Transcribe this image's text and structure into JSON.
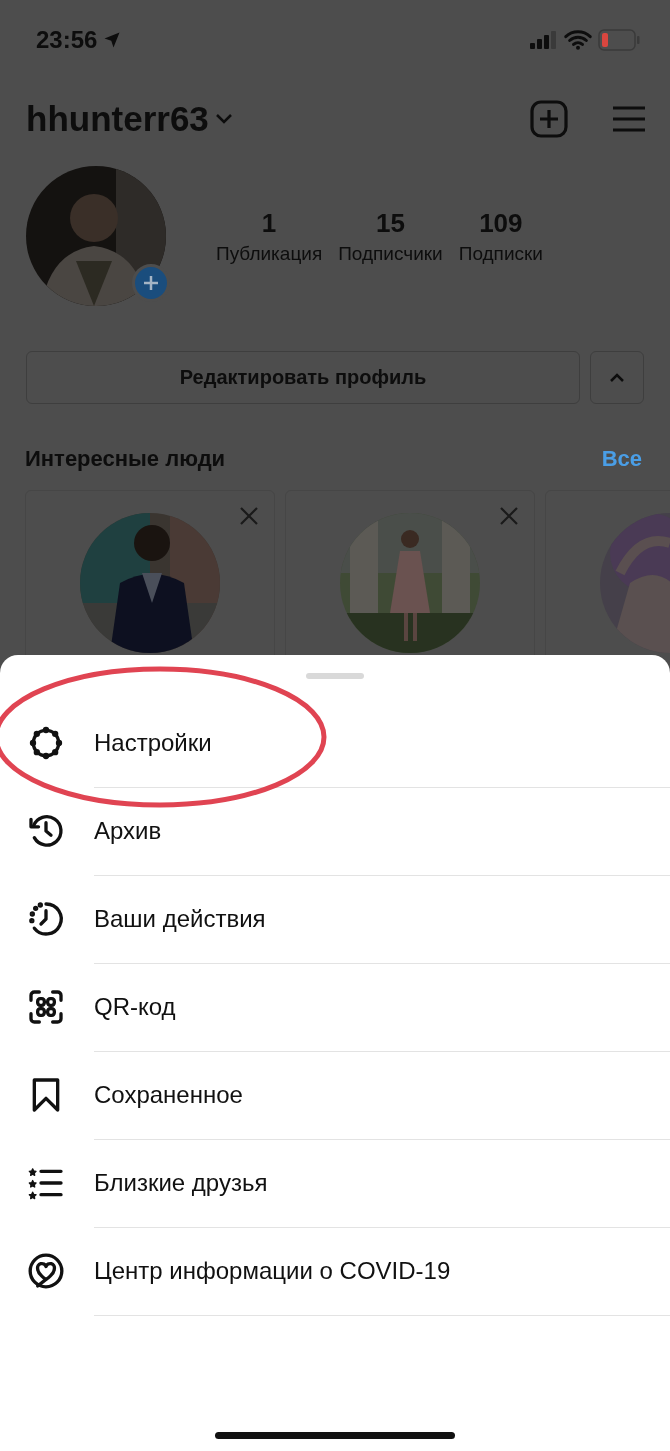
{
  "status_bar": {
    "time": "23:56"
  },
  "header": {
    "username": "hhunterr63"
  },
  "stats": [
    {
      "value": "1",
      "label": "Публикация"
    },
    {
      "value": "15",
      "label": "Подписчики"
    },
    {
      "value": "109",
      "label": "Подписки"
    }
  ],
  "edit_button": {
    "label": "Редактировать профиль"
  },
  "suggestions": {
    "title": "Интересные люди",
    "see_all": "Все",
    "cards": [
      {
        "kind": "boy"
      },
      {
        "kind": "dress"
      },
      {
        "kind": "purple"
      }
    ]
  },
  "menu": {
    "items": [
      {
        "kind": "gear",
        "label": "Настройки",
        "annotated": true
      },
      {
        "kind": "archive",
        "label": "Архив",
        "annotated": false
      },
      {
        "kind": "activity",
        "label": "Ваши действия",
        "annotated": false
      },
      {
        "kind": "qr",
        "label": "QR-код",
        "annotated": false
      },
      {
        "kind": "saved",
        "label": "Сохраненное",
        "annotated": false
      },
      {
        "kind": "friends",
        "label": "Близкие друзья",
        "annotated": false
      },
      {
        "kind": "covid",
        "label": "Центр информации о COVID-19",
        "annotated": false
      }
    ]
  }
}
